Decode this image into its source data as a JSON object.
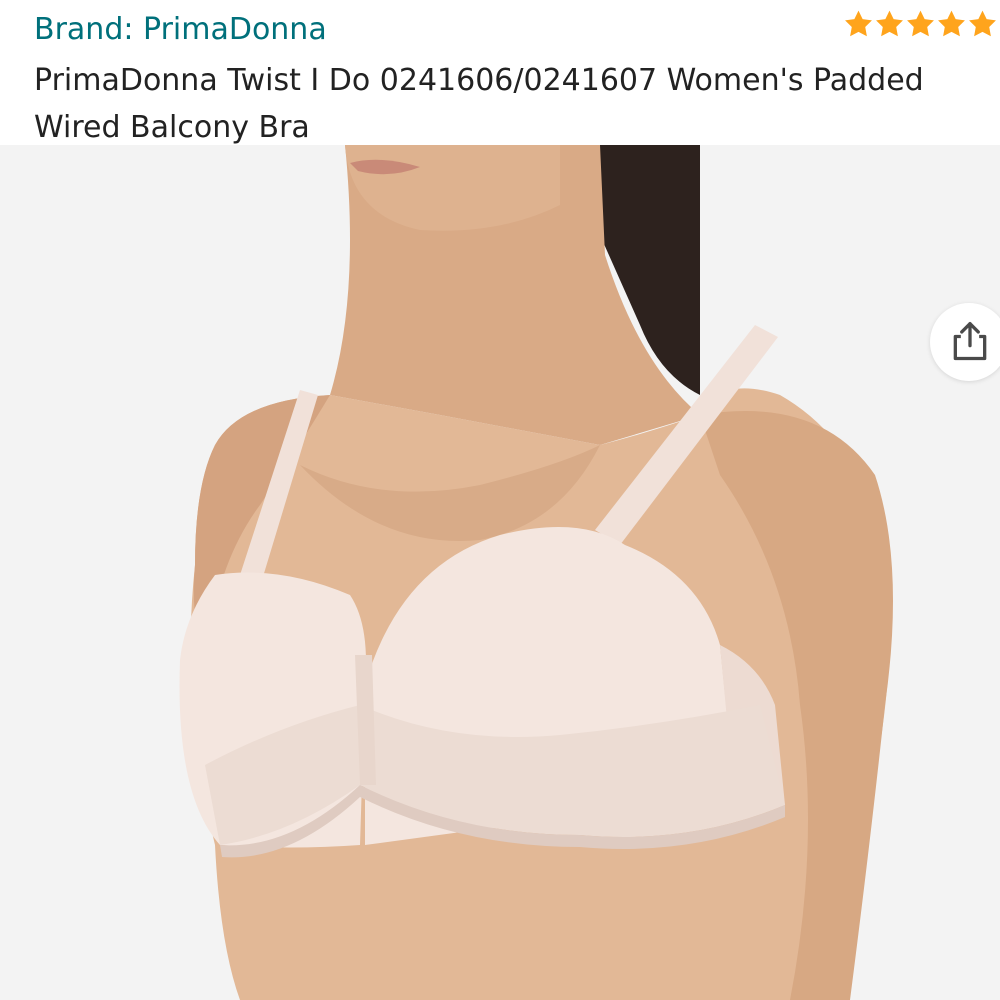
{
  "brand": {
    "link_text": "Brand: PrimaDonna"
  },
  "rating": {
    "stars": 5,
    "star_color": "#ffa41c"
  },
  "product": {
    "title": "PrimaDonna Twist I Do 0241606/0241607 Women's Padded Wired Balcony Bra"
  },
  "image": {
    "icon": "share-icon"
  },
  "colors": {
    "brand_link": "#00707b",
    "title_text": "#222222",
    "image_bg": "#f3f3f3",
    "skin": "#e2b896",
    "garment": "#f4e6df"
  }
}
